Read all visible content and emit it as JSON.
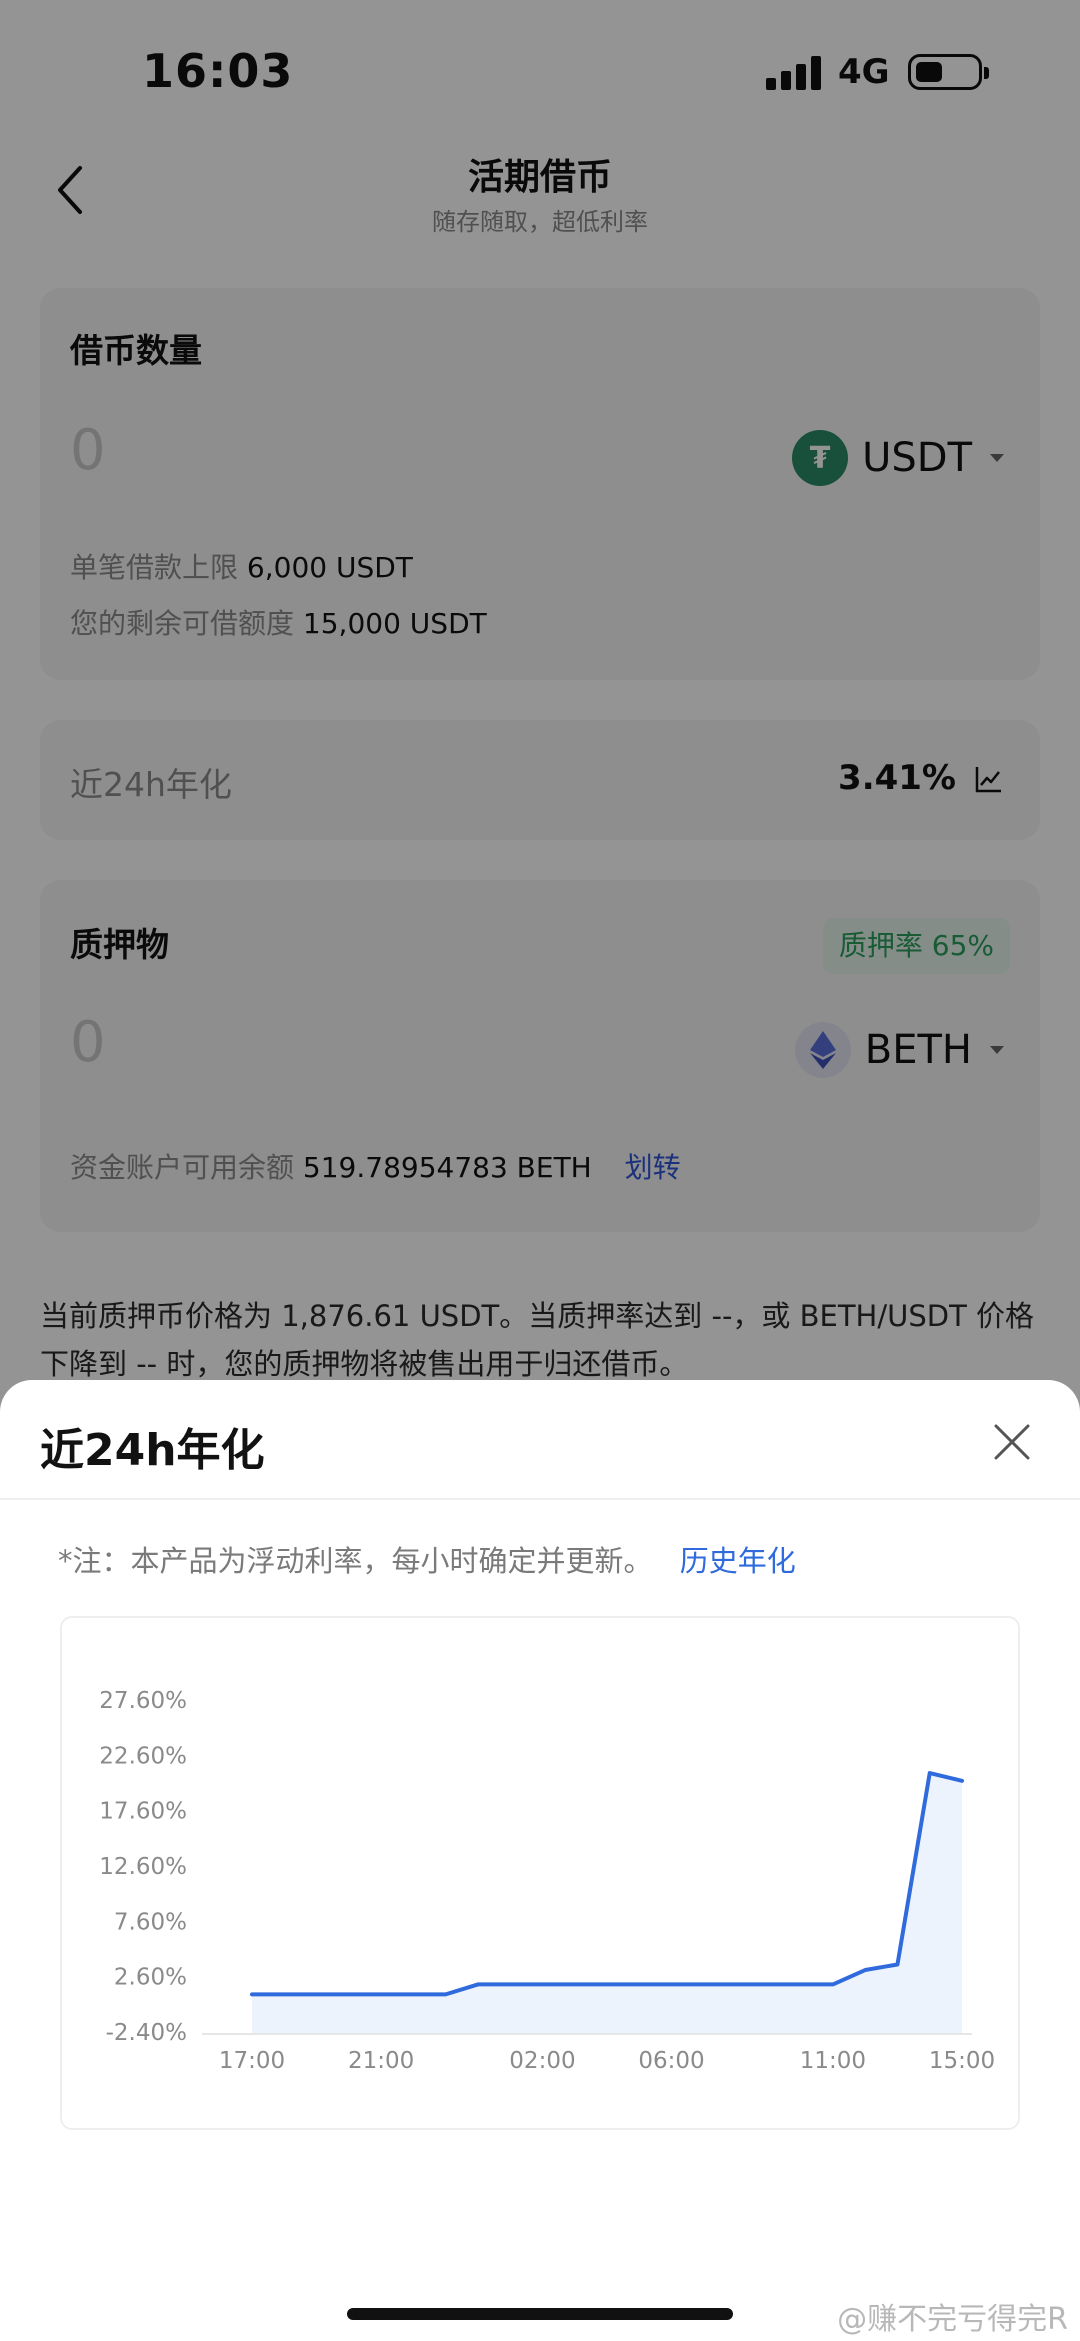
{
  "status_bar": {
    "time": "16:03",
    "network": "4G"
  },
  "nav": {
    "title": "活期借币",
    "subtitle": "随存随取，超低利率"
  },
  "borrow_card": {
    "title": "借币数量",
    "input_value": "0",
    "coin_label": "USDT",
    "limit_label": "单笔借款上限",
    "limit_value": "6,000 USDT",
    "remaining_label": "您的剩余可借额度",
    "remaining_value": "15,000 USDT"
  },
  "rate_card": {
    "label": "近24h年化",
    "value": "3.41%"
  },
  "collateral_card": {
    "title": "质押物",
    "badge": "质押率 65%",
    "input_value": "0",
    "coin_label": "BETH",
    "balance_label": "资金账户可用余额",
    "balance_value": "519.78954783 BETH",
    "transfer_link": "划转"
  },
  "notice": "当前质押币价格为 1,876.61 USDT。当质押率达到 --，或 BETH/USDT 价格下降到 -- 时，您的质押物将被售出用于归还借币。",
  "sheet": {
    "title": "近24h年化",
    "note": "*注：本产品为浮动利率，每小时确定并更新。",
    "history_link": "历史年化"
  },
  "chart_data": {
    "type": "area",
    "y_ticks": [
      "27.60%",
      "22.60%",
      "17.60%",
      "12.60%",
      "7.60%",
      "2.60%",
      "-2.40%"
    ],
    "ylim": [
      -2.4,
      27.6
    ],
    "x_ticks": [
      {
        "label": "17:00",
        "x": 0
      },
      {
        "label": "21:00",
        "x": 4
      },
      {
        "label": "02:00",
        "x": 9
      },
      {
        "label": "06:00",
        "x": 13
      },
      {
        "label": "11:00",
        "x": 18
      },
      {
        "label": "15:00",
        "x": 22
      }
    ],
    "xlim": [
      0,
      22
    ],
    "series": [
      {
        "values": [
          {
            "x": 0,
            "y": 1.0
          },
          {
            "x": 6,
            "y": 1.0
          },
          {
            "x": 7,
            "y": 1.9
          },
          {
            "x": 18,
            "y": 1.9
          },
          {
            "x": 19,
            "y": 3.2
          },
          {
            "x": 20,
            "y": 3.7
          },
          {
            "x": 21,
            "y": 21.0
          },
          {
            "x": 22,
            "y": 20.3
          }
        ]
      }
    ],
    "line_color": "#2f6bdc",
    "fill_color": "#edf3fd",
    "grid": false
  },
  "watermark": "@赚不完亏得完R"
}
